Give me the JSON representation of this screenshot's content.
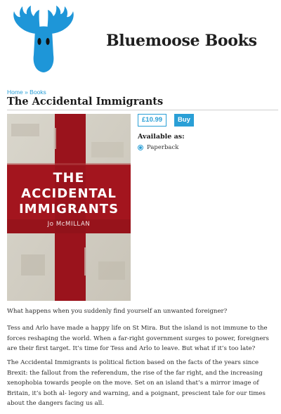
{
  "site": {
    "name": "Bluemoose Books"
  },
  "breadcrumb": {
    "home": "Home",
    "separator": "»",
    "section": "Books"
  },
  "book": {
    "title": "The Accidental Immigrants",
    "cover": {
      "line1": "THE",
      "line2": "ACCIDENTAL",
      "line3": "IMMIGRANTS",
      "author": "Jo McMILLAN"
    },
    "price": "£10.99",
    "buy_label": "Buy",
    "available_label": "Available as:",
    "formats": [
      {
        "label": "Paperback",
        "selected": true
      }
    ]
  },
  "description": [
    "What happens when you suddenly find yourself an unwanted foreigner?",
    "Tess and Arlo have made a happy life on St Mira. But the island is not immune to the forces reshaping the world. When a far-right government surges to power, foreigners are their first target. It’s time for Tess and Arlo to leave. But what if it’s too late?",
    "The Accidental Immigrants is political fiction based on the facts of the years since Brexit: the fallout from the referendum, the rise of the far right, and the increasing xenophobia towards people on the move. Set on an island that’s a mirror image of Britain, it’s both al- legory and warning, and a poignant, prescient tale for our times about the dangers facing us all."
  ],
  "colors": {
    "accent": "#2a9fd6",
    "moose": "#1e96d8",
    "cross": "#a3151e"
  }
}
